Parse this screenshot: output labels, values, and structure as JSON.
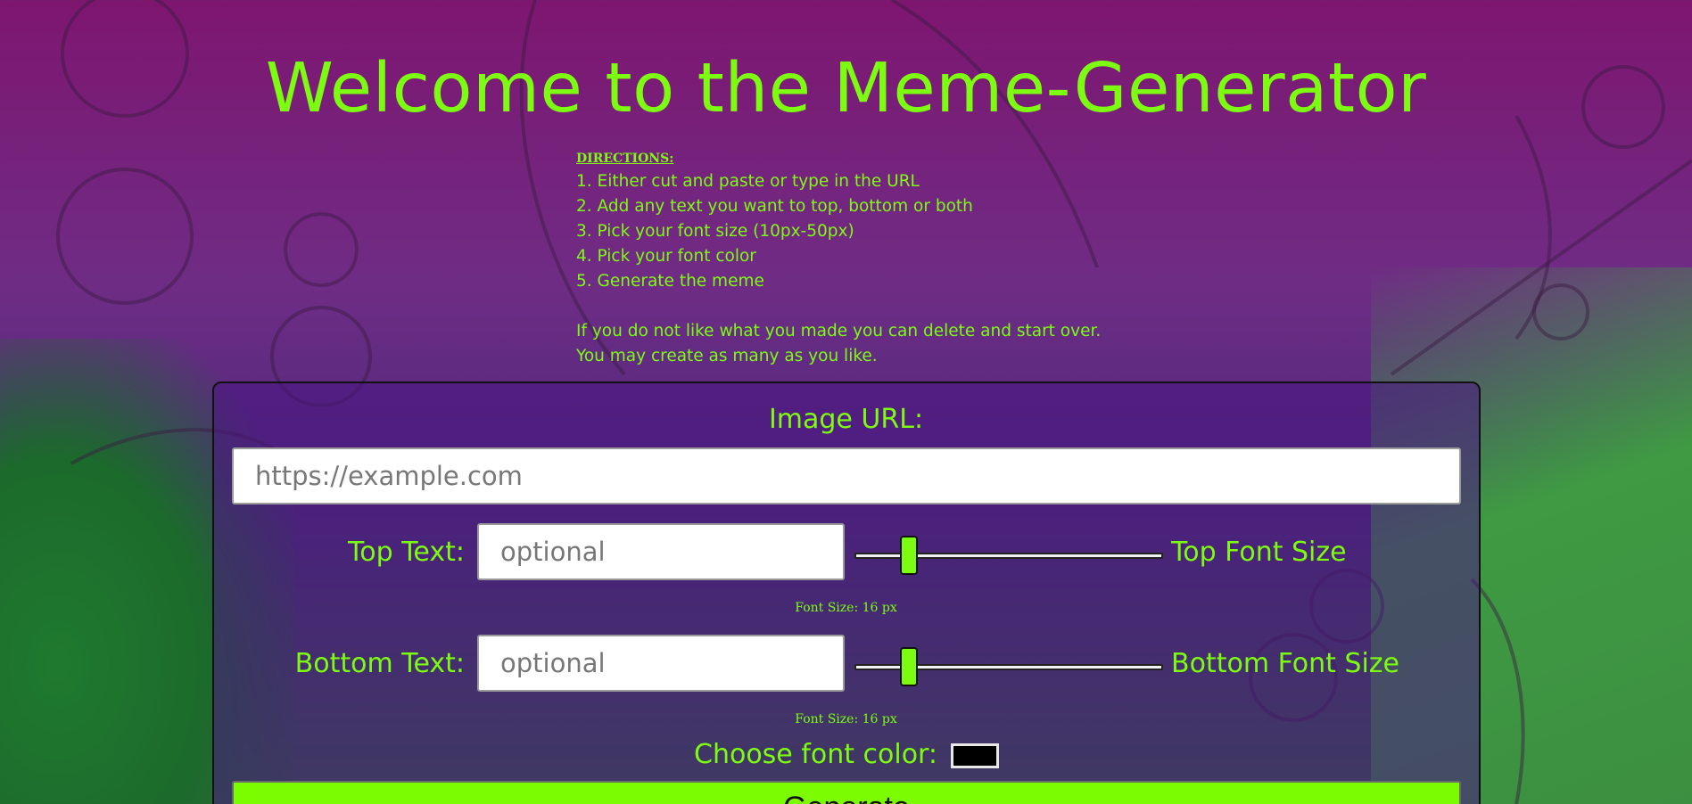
{
  "page": {
    "title": "Welcome to the Meme-Generator"
  },
  "directions": {
    "heading": "DIRECTIONS:",
    "steps": [
      "1. Either cut and paste or type in the URL",
      "2. Add any text you want to top, bottom or both",
      "3. Pick your font size (10px-50px)",
      "4. Pick your font color",
      "5. Generate the meme"
    ],
    "notes": [
      "If you do not like what you made you can delete and start over.",
      "You may create as many as you like."
    ]
  },
  "form": {
    "image_url_label": "Image URL:",
    "image_url_placeholder": "https://example.com",
    "image_url_value": "",
    "top_text_label": "Top Text:",
    "top_text_placeholder": "optional",
    "top_font_size_label": "Top Font Size",
    "top_font_size_readout": "Font Size: 16 px",
    "top_font_size_value": 16,
    "bottom_text_label": "Bottom Text:",
    "bottom_text_placeholder": "optional",
    "bottom_font_size_label": "Bottom Font Size",
    "bottom_font_size_readout": "Font Size: 16 px",
    "bottom_font_size_value": 16,
    "font_size_min": 10,
    "font_size_max": 50,
    "font_color_label": "Choose font color:",
    "font_color_value": "#000000",
    "generate_label": "Generate"
  },
  "colors": {
    "accent": "#7cfc10",
    "panel": "#4b1482",
    "button": "#7cfc00"
  }
}
